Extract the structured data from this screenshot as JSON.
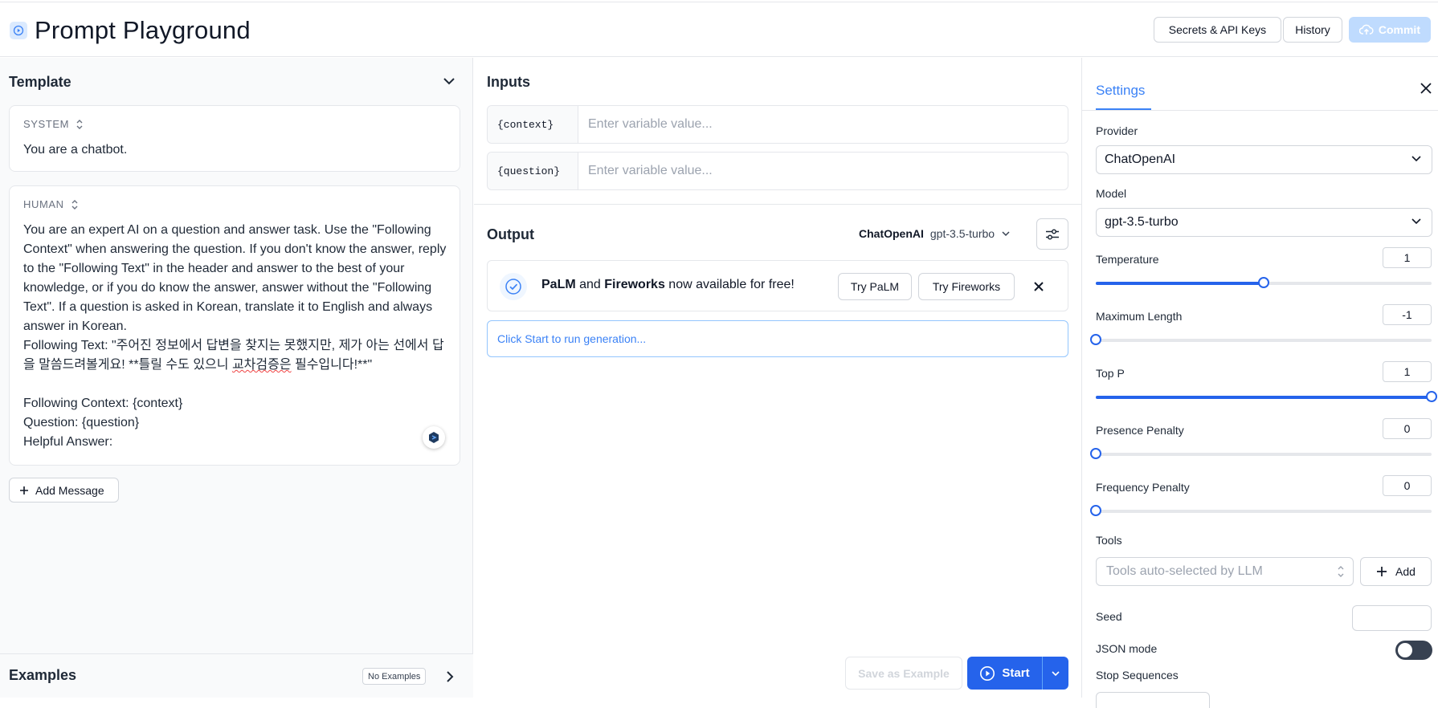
{
  "header": {
    "title": "Prompt Playground",
    "logo_icon": "play-circle-icon",
    "buttons": {
      "secrets": "Secrets & API Keys",
      "history": "History",
      "commit": "Commit"
    }
  },
  "template": {
    "title": "Template",
    "messages": [
      {
        "role": "SYSTEM",
        "text": "You are a chatbot."
      },
      {
        "role": "HUMAN",
        "text_a": "You are an expert AI on a question and answer task. Use the \"Following Context\" when answering the question. If you don't know the answer, reply to the \"Following Text\" in the header and answer to the best of your knowledge, or if you do know the answer, answer without the \"Following Text\". If a question is asked in Korean, translate it to English and always answer in Korean.\nFollowing Text: \"주어진 정보에서 답변을 찾지는 못했지만, 제가 아는 선에서 답을 말씀드려볼게요! **틀릴 수도 있으니 ",
        "text_misspelled": "교차검증은",
        "text_b": " 필수입니다!**\"\n\nFollowing Context: {context}\nQuestion: {question}\nHelpful Answer:"
      }
    ],
    "add_message": "Add Message"
  },
  "examples": {
    "title": "Examples",
    "badge": "No Examples"
  },
  "inputs": {
    "title": "Inputs",
    "variables": [
      {
        "name": "{context}",
        "placeholder": "Enter variable value..."
      },
      {
        "name": "{question}",
        "placeholder": "Enter variable value..."
      }
    ]
  },
  "output": {
    "title": "Output",
    "provider": "ChatOpenAI",
    "model": "gpt-3.5-turbo",
    "promo": {
      "name1": "PaLM",
      "and": " and ",
      "name2": "Fireworks",
      "rest": " now available for free!",
      "try_palm": "Try PaLM",
      "try_fireworks": "Try Fireworks"
    },
    "placeholder": "Click Start to run generation...",
    "save_example": "Save as Example",
    "start": "Start"
  },
  "settings": {
    "tab": "Settings",
    "provider_label": "Provider",
    "provider_value": "ChatOpenAI",
    "model_label": "Model",
    "model_value": "gpt-3.5-turbo",
    "params": [
      {
        "label": "Temperature",
        "value": "1",
        "fraction": 0.5
      },
      {
        "label": "Maximum Length",
        "value": "-1",
        "fraction": 0.0
      },
      {
        "label": "Top P",
        "value": "1",
        "fraction": 1.0
      },
      {
        "label": "Presence Penalty",
        "value": "0",
        "fraction": 0.0
      },
      {
        "label": "Frequency Penalty",
        "value": "0",
        "fraction": 0.0
      }
    ],
    "tools_label": "Tools",
    "tools_placeholder": "Tools auto-selected by LLM",
    "tools_add": "Add",
    "seed_label": "Seed",
    "json_mode_label": "JSON mode",
    "json_mode_on": false,
    "stop_label": "Stop Sequences"
  },
  "colors": {
    "accent": "#2563eb",
    "accent_light": "#3b82f6",
    "commit_disabled": "#bfdbfe"
  }
}
